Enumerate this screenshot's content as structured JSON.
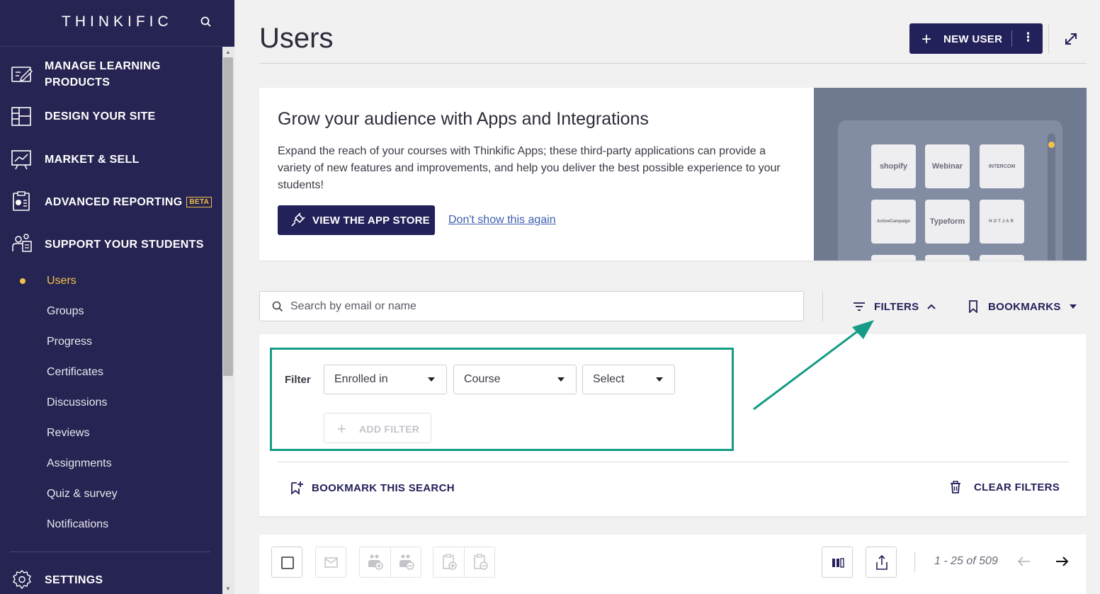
{
  "sidebar": {
    "brand": "THINKIFIC",
    "nav": [
      {
        "label": "MANAGE LEARNING PRODUCTS",
        "icon": "course-edit-icon"
      },
      {
        "label": "DESIGN YOUR SITE",
        "icon": "layout-icon"
      },
      {
        "label": "MARKET & SELL",
        "icon": "chart-board-icon"
      },
      {
        "label": "ADVANCED REPORTING",
        "icon": "report-icon",
        "badge": "BETA"
      },
      {
        "label": "SUPPORT YOUR STUDENTS",
        "icon": "people-icon"
      }
    ],
    "sub_items": [
      "Users",
      "Groups",
      "Progress",
      "Certificates",
      "Discussions",
      "Reviews",
      "Assignments",
      "Quiz & survey",
      "Notifications"
    ],
    "active_sub_item": "Users",
    "settings": {
      "label": "SETTINGS",
      "icon": "gear-icon"
    }
  },
  "header": {
    "title": "Users",
    "new_user_label": "NEW USER"
  },
  "promo": {
    "title": "Grow your audience with Apps and Integrations",
    "body": "Expand the reach of your courses with Thinkific Apps; these third-party applications can provide a variety of new features and improvements, and help you deliver the best possible experience to your students!",
    "cta_label": "VIEW THE APP STORE",
    "dismiss_label": "Don't show this again",
    "tiles": [
      "shopify",
      "Webinar",
      "INTERCOM",
      "ActiveCampaign",
      "Typeform",
      "HOTJAR"
    ]
  },
  "search": {
    "placeholder": "Search by email or name",
    "filters_label": "FILTERS",
    "bookmarks_label": "BOOKMARKS"
  },
  "filters": {
    "label": "Filter",
    "selects": [
      "Enrolled in",
      "Course",
      "Select"
    ],
    "add_filter_label": "ADD FILTER",
    "bookmark_search_label": "BOOKMARK THIS SEARCH",
    "clear_filters_label": "CLEAR FILTERS"
  },
  "table_toolbar": {
    "pagination": "1 - 25 of 509"
  },
  "colors": {
    "sidebar_bg": "#262452",
    "primary": "#23215a",
    "active": "#f3c24b",
    "highlight": "#169c86"
  }
}
